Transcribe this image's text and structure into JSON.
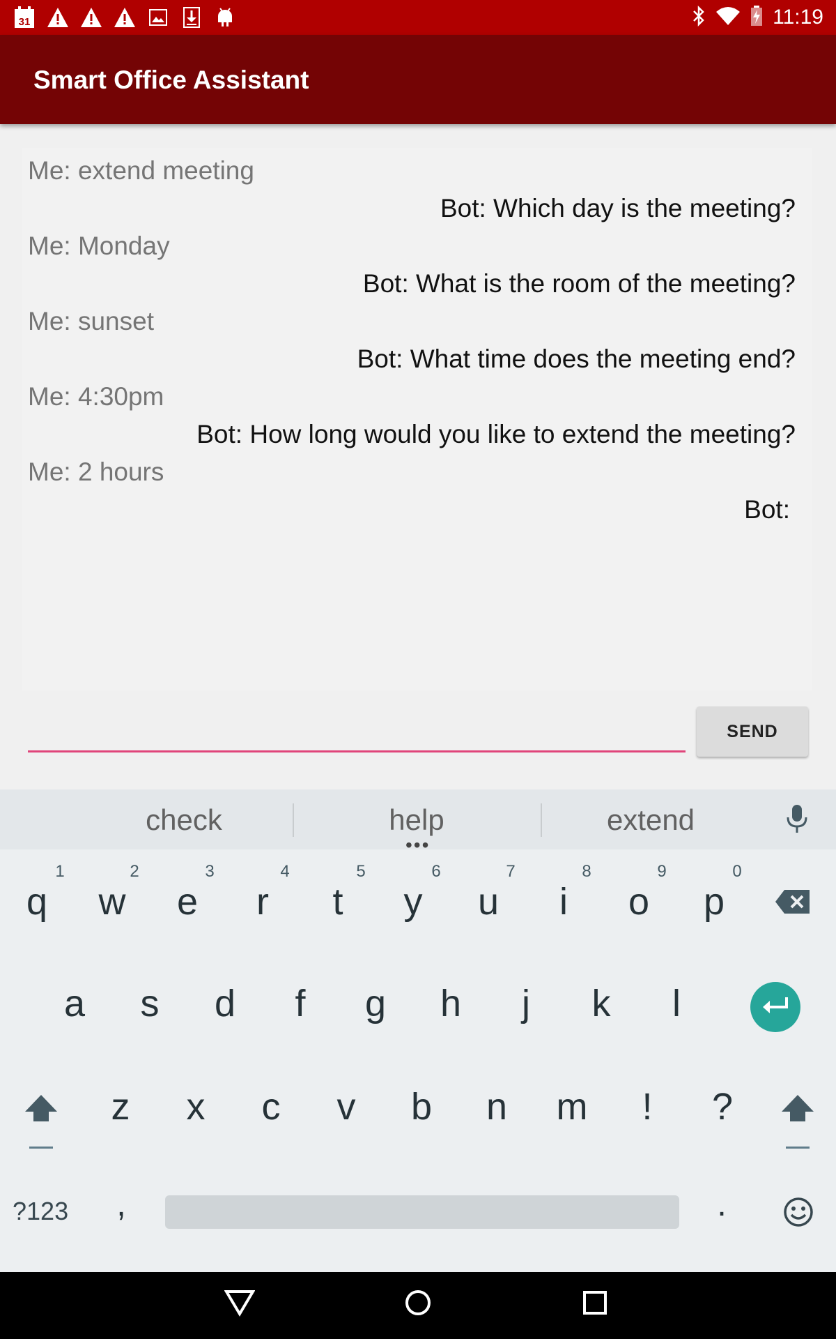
{
  "status_bar": {
    "time": "11:19",
    "calendar_day": "31",
    "icons_left": [
      "calendar-icon",
      "warning-icon",
      "warning-icon",
      "warning-icon",
      "image-icon",
      "download-icon",
      "android-icon"
    ],
    "icons_right": [
      "bluetooth-icon",
      "wifi-icon",
      "battery-charging-icon"
    ]
  },
  "app_bar": {
    "title": "Smart Office Assistant",
    "background": "#740405"
  },
  "chat": {
    "messages": [
      {
        "sender": "me",
        "text": "Me: extend meeting"
      },
      {
        "sender": "bot",
        "text": "Bot: Which day is the meeting?"
      },
      {
        "sender": "me",
        "text": "Me: Monday"
      },
      {
        "sender": "bot",
        "text": "Bot: What is the room of the meeting?"
      },
      {
        "sender": "me",
        "text": "Me: sunset"
      },
      {
        "sender": "bot",
        "text": "Bot: What time does the meeting end?"
      },
      {
        "sender": "me",
        "text": "Me: 4:30pm"
      },
      {
        "sender": "bot",
        "text": "Bot: How long would you like to extend the meeting?"
      },
      {
        "sender": "me",
        "text": "Me: 2 hours"
      },
      {
        "sender": "bot",
        "text": "Bot:"
      }
    ]
  },
  "composer": {
    "input_value": "",
    "send_label": "SEND",
    "underline_color": "#e0457a"
  },
  "keyboard": {
    "suggestions": [
      "check",
      "help",
      "extend"
    ],
    "row1": [
      "q",
      "w",
      "e",
      "r",
      "t",
      "y",
      "u",
      "i",
      "o",
      "p"
    ],
    "row1_numbers": [
      "1",
      "2",
      "3",
      "4",
      "5",
      "6",
      "7",
      "8",
      "9",
      "0"
    ],
    "row2": [
      "a",
      "s",
      "d",
      "f",
      "g",
      "h",
      "j",
      "k",
      "l"
    ],
    "row3": [
      "z",
      "x",
      "c",
      "v",
      "b",
      "n",
      "m",
      "!",
      "?"
    ],
    "symbols_label": "?123",
    "comma": ",",
    "period": ".",
    "enter_color": "#26a69a"
  },
  "nav_bar": {
    "icons": [
      "back-icon",
      "home-icon",
      "recents-icon"
    ]
  }
}
